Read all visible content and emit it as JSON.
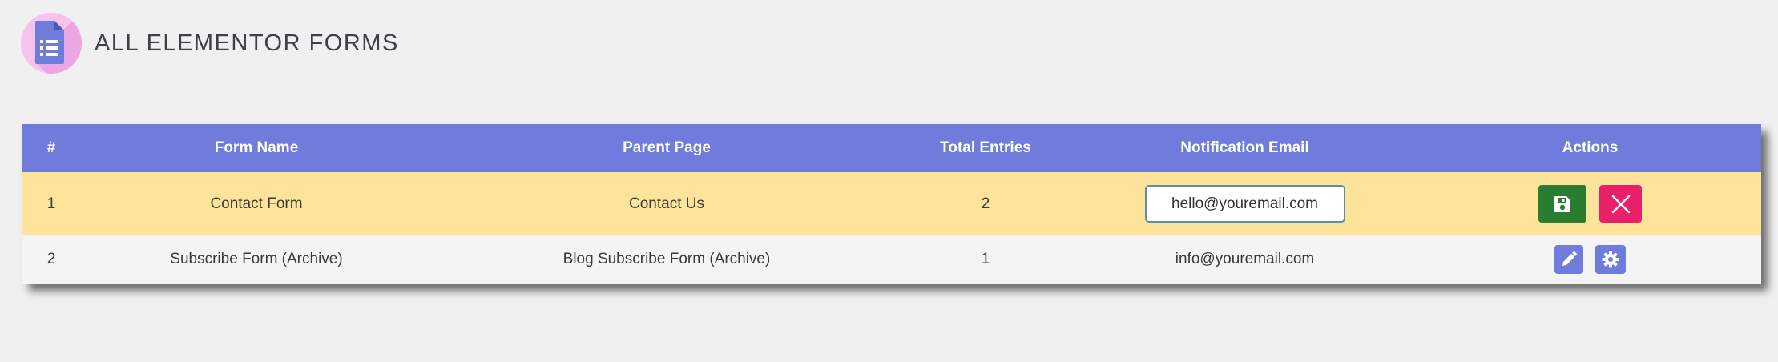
{
  "header": {
    "title": "ALL ELEMENTOR FORMS",
    "logo_icon": "form-list-icon"
  },
  "colors": {
    "header_bg": "#6f7cdb",
    "editing_row_bg": "#fde49a",
    "save_button": "#2a7d2e",
    "cancel_button": "#ea1f6a",
    "action_button": "#6f7cdb"
  },
  "table": {
    "columns": [
      "#",
      "Form Name",
      "Parent Page",
      "Total Entries",
      "Notification Email",
      "Actions"
    ],
    "rows": [
      {
        "num": "1",
        "form_name": "Contact Form",
        "parent_page": "Contact Us",
        "total_entries": "2",
        "notification_email": "hello@youremail.com",
        "editing": true,
        "actions": [
          "save-icon",
          "close-icon"
        ]
      },
      {
        "num": "2",
        "form_name": "Subscribe Form (Archive)",
        "parent_page": "Blog Subscribe Form (Archive)",
        "total_entries": "1",
        "notification_email": "info@youremail.com",
        "editing": false,
        "actions": [
          "pencil-icon",
          "gear-icon"
        ]
      }
    ]
  }
}
